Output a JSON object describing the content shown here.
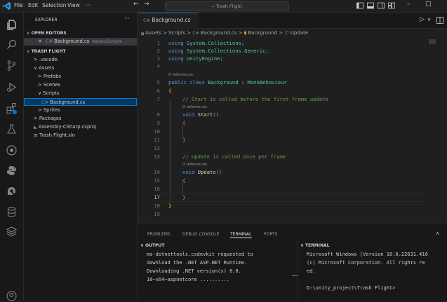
{
  "titlebar": {
    "menus": [
      "File",
      "Edit",
      "Selection",
      "View",
      "···"
    ],
    "search": "Trash Flight",
    "nav_back": "←",
    "nav_forward": "→",
    "minimize": "–",
    "restore": "□"
  },
  "explorer": {
    "title": "EXPLORER",
    "more": "···",
    "open_editors_title": "OPEN EDITORS",
    "open_editor": {
      "name": "Background.cs",
      "path": "Assets\\Scripts"
    },
    "project_title": "TRASH FLIGHT",
    "tree": [
      {
        "label": "> .vscode",
        "indent": 1
      },
      {
        "label": "∨ Assets",
        "indent": 1
      },
      {
        "label": "> Prefabs",
        "indent": 2
      },
      {
        "label": "> Scenes",
        "indent": 2
      },
      {
        "label": "∨ Scripts",
        "indent": 2
      },
      {
        "label": "Background.cs",
        "indent": 3,
        "selected": true
      },
      {
        "label": "> Sprites",
        "indent": 2
      },
      {
        "label": "> Packages",
        "indent": 1
      },
      {
        "label": "Assembly-CSharp.csproj",
        "indent": 1
      },
      {
        "label": "Trash Flight.sln",
        "indent": 1
      }
    ]
  },
  "editor": {
    "tab_label": "Background.cs",
    "breadcrumb": [
      "Assets",
      "Scripts",
      "Background.cs",
      "Background",
      "Update"
    ],
    "lines": [
      "1",
      "2",
      "3",
      "4",
      "5",
      "6",
      "7",
      "8",
      "9",
      "10",
      "11",
      "12",
      "13",
      "14",
      "15",
      "16",
      "17",
      "18",
      "19"
    ],
    "code": {
      "l1_kw": "using",
      "l1_ns": "System.Collections;",
      "l2_kw": "using",
      "l2_ns": "System.Collections.Generic;",
      "l3_kw": "using",
      "l3_ns": "UnityEngine;",
      "refs": "0 references",
      "l5_kw": "public class",
      "l5_name": "Background",
      "l5_sep": ":",
      "l5_base": "MonoBehaviour",
      "open_brace": "{",
      "close_brace": "}",
      "l7_comment": "// Start is called before the first frame update",
      "l8_kw": "void",
      "l8_fn": "Start",
      "l8_paren": "()",
      "l13_comment": "// Update is called once per frame",
      "l14_kw": "void",
      "l14_fn": "Update",
      "l14_paren": "()"
    }
  },
  "panel": {
    "tabs": [
      "PROBLEMS",
      "DEBUG CONSOLE",
      "TERMINAL",
      "PORTS"
    ],
    "active_tab": "TERMINAL",
    "output_title": "OUTPUT",
    "terminal_title": "TERMINAL",
    "output_lines": [
      "ms-dotnettools.csdevkit requested to",
      "download the .NET ASP.NET Runtime.",
      "Downloading .NET version(s) 8.0.",
      "10~x64~aspnetcore .........."
    ],
    "terminal_lines": [
      "Microsoft Windows [Version 10.0.22631.416",
      "(c) Microsoft Corporation. All rights re",
      "ed.",
      "",
      "D:\\unity_project\\Trash Flight>"
    ]
  },
  "colors": {
    "accent": "#0078d4",
    "background": "#1f1f1f",
    "sidebar": "#181818"
  }
}
